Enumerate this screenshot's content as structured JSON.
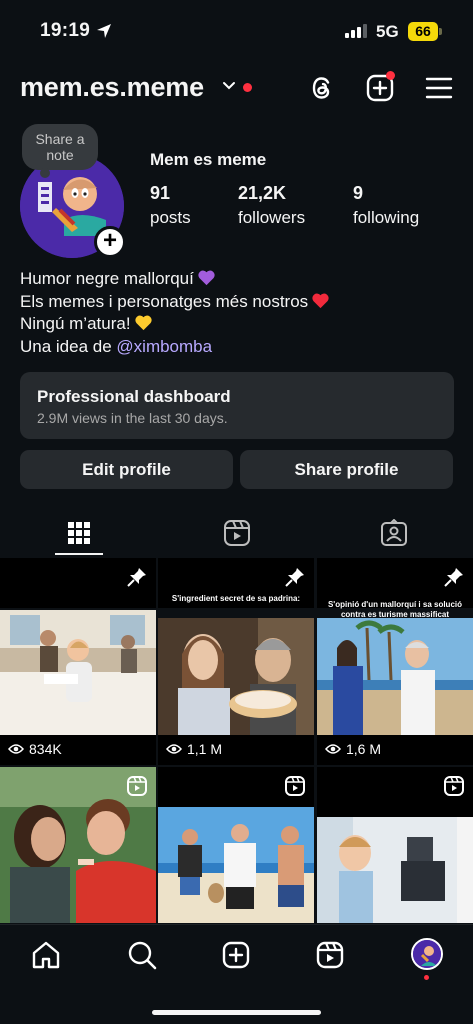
{
  "status_bar": {
    "time": "19:19",
    "network": "5G",
    "battery": "66",
    "icons": [
      "location-arrow-icon",
      "signal-icon",
      "battery-icon"
    ]
  },
  "header": {
    "username": "mem.es.meme",
    "icons": [
      "chevron-down-icon",
      "threads-icon",
      "create-icon",
      "menu-icon"
    ],
    "accent_color": "#ff3040"
  },
  "profile": {
    "note": "Share a note",
    "display_name": "Mem es meme",
    "avatar_badge": "+",
    "stats": [
      {
        "value": "91",
        "label": "posts"
      },
      {
        "value": "21,2K",
        "label": "followers"
      },
      {
        "value": "9",
        "label": "following"
      }
    ],
    "bio": {
      "line1": "Humor negre mallorquí",
      "line2": "Els memes i personatges més nostros",
      "line3": "Ningú m’atura!",
      "line4_prefix": "Una idea de ",
      "line4_link": "@ximbomba"
    },
    "bio_emojis": [
      "purple-heart-icon",
      "red-heart-icon",
      "yellow-heart-icon"
    ]
  },
  "pro_dashboard": {
    "title": "Professional dashboard",
    "subtitle": "2.9M views in the last 30 days."
  },
  "buttons": {
    "edit": "Edit profile",
    "share": "Share profile"
  },
  "tabs": [
    "grid-icon",
    "reels-icon",
    "tagged-icon"
  ],
  "grid": {
    "posts": [
      {
        "views": "834K",
        "caption": "",
        "pinned": true
      },
      {
        "views": "1,1 M",
        "caption": "S'ingredient secret de sa padrina:",
        "pinned": true
      },
      {
        "views": "1,6 M",
        "caption": "S'opinió d'un mallorquí i sa solució contra es turisme massificat",
        "pinned": true
      },
      {
        "views": "",
        "caption": "",
        "reel": true
      },
      {
        "views": "",
        "caption": "",
        "reel": true
      },
      {
        "views": "",
        "caption": "",
        "reel": true
      }
    ]
  },
  "bottom_nav": [
    "home-icon",
    "search-icon",
    "create-icon",
    "reels-icon",
    "profile-avatar"
  ]
}
